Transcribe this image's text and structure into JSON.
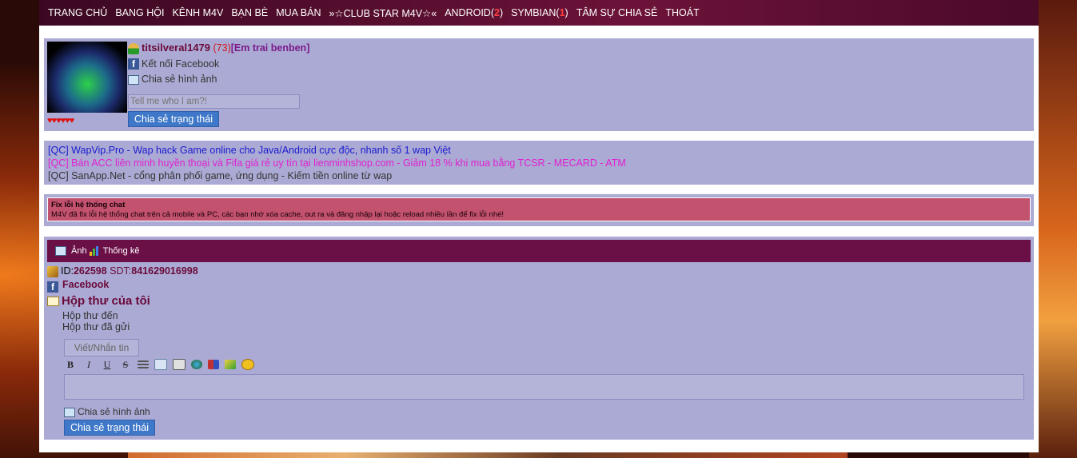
{
  "nav": {
    "items": [
      {
        "label": "TRANG CHỦ"
      },
      {
        "label": "BANG HỘI"
      },
      {
        "label": "KÊNH M4V"
      },
      {
        "label": "BẠN BÈ"
      },
      {
        "label": "MUA BÁN"
      },
      {
        "label": "»☆CLUB STAR M4V☆«"
      },
      {
        "label": "ANDROID(",
        "count": "2",
        "suffix": ")"
      },
      {
        "label": "SYMBIAN(",
        "count": "1",
        "suffix": ")"
      },
      {
        "label": "TÂM SỰ CHIA SẺ"
      },
      {
        "label": "THOÁT"
      }
    ]
  },
  "profile": {
    "username": "titsilveral1479",
    "count_open": " (",
    "count": "73",
    "count_close": ")",
    "title": "[Em trai benben]",
    "hearts": "♥♥♥♥♥♥",
    "facebook_label": "Kết nối Facebook",
    "share_image": "Chia sẻ hình ảnh",
    "status_placeholder": "Tell me who I am?!",
    "share_status_button": "Chia sẻ trạng thái"
  },
  "ads": [
    "[QC] WapVip.Pro - Wap hack Game online cho Java/Android cực độc, nhanh số 1 wap Việt",
    "[QC] Bán ACC liên minh huyền thoại và Fifa giá rẻ uy tín tại lienminhshop.com - Giảm 18 % khi mua bằng TCSR - MECARD - ATM",
    "[QC] SanApp.Net - cổng phân phối game, ứng dụng - Kiếm tiền online từ wap"
  ],
  "notice": {
    "title": "Fix lỗi hệ thống chat",
    "body": "M4V đã fix lỗi hệ thống chat trên cả mobile và PC, các bạn nhớ xóa cache, out ra và đăng nhập lại hoặc reload nhiều lần để fix lỗi nhé!"
  },
  "section": {
    "tab_image": "Ảnh",
    "tab_stats": "Thống kê",
    "id_label": "ID:",
    "id_value": "262598",
    "sdt_label": " SDT:",
    "sdt_value": "841629016998",
    "facebook": "Facebook",
    "mailbox_title": "Hộp thư của tôi",
    "inbox": "Hộp thư đến",
    "sent": "Hộp thư đã gửi",
    "compose_button": "Viết/Nhắn tin",
    "toolbar": {
      "bold": "B",
      "italic": "I",
      "underline": "U",
      "strike": "S"
    },
    "share_image": "Chia sẻ hình ảnh",
    "share_status_button": "Chia sẻ trạng thái"
  },
  "colors": {
    "nav_bg": "#6c1238",
    "panel_bg": "#abaad4",
    "notice_bg": "#c2526e",
    "section_header": "#6b0f47",
    "button": "#3f78c8"
  }
}
